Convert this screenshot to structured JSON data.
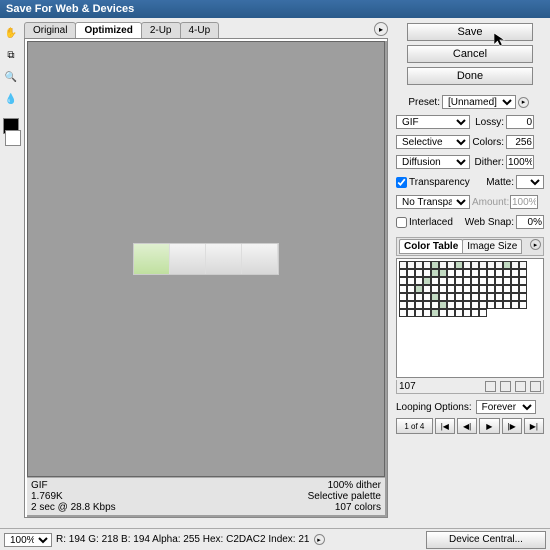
{
  "window": {
    "title": "Save For Web & Devices"
  },
  "tabs": [
    "Original",
    "Optimized",
    "2-Up",
    "4-Up"
  ],
  "active_tab": "Optimized",
  "preview_info": {
    "format": "GIF",
    "size": "1.769K",
    "timing": "2 sec @ 28.8 Kbps",
    "dither": "100% dither",
    "palette": "Selective palette",
    "colors": "107 colors"
  },
  "buttons": {
    "save": "Save",
    "cancel": "Cancel",
    "done": "Done"
  },
  "settings": {
    "preset_label": "Preset:",
    "preset_value": "[Unnamed]",
    "format": "GIF",
    "lossy_label": "Lossy:",
    "lossy_value": "0",
    "reduction": "Selective",
    "colors_label": "Colors:",
    "colors_value": "256",
    "dither_method": "Diffusion",
    "dither_label": "Dither:",
    "dither_value": "100%",
    "transparency_label": "Transparency",
    "matte_label": "Matte:",
    "trans_dither": "No Transparency ...",
    "amount_label": "Amount:",
    "amount_value": "100%",
    "interlaced_label": "Interlaced",
    "websnap_label": "Web Snap:",
    "websnap_value": "0%"
  },
  "color_table": {
    "tab1": "Color Table",
    "tab2": "Image Size",
    "count": "107"
  },
  "looping": {
    "label": "Looping Options:",
    "value": "Forever",
    "frame_text": "1 of 4"
  },
  "status": {
    "zoom": "100%",
    "readout": "R:   194   G:   218   B:   194   Alpha:   255   Hex:   C2DAC2   Index:    21"
  },
  "device_central": "Device Central...",
  "icons": {
    "hand": "✋",
    "slice": "⧉",
    "zoom": "🔍",
    "eyedrop": "💧",
    "flyout": "▸",
    "first": "|◀",
    "prev": "◀|",
    "play": "▶",
    "next": "|▶",
    "last": "▶|"
  }
}
